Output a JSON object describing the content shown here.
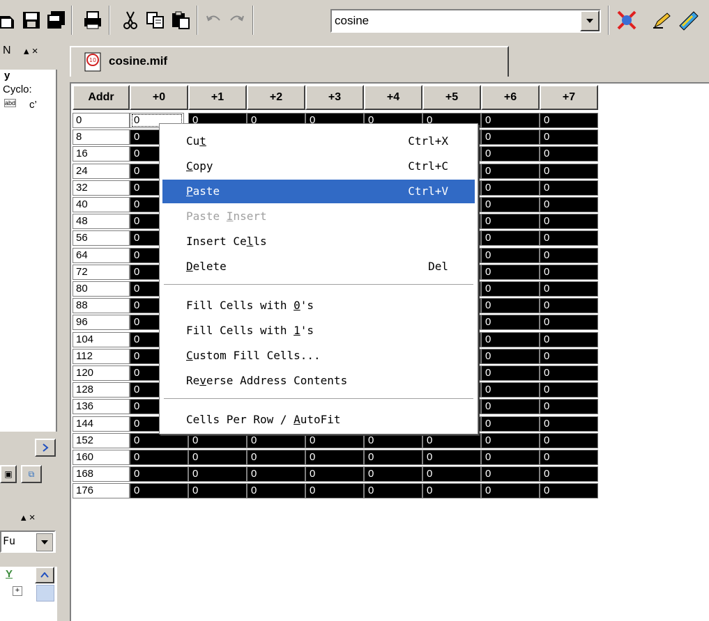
{
  "toolbar": {
    "combo_value": "cosine",
    "buttons": [
      "open-icon",
      "save-icon",
      "save-all-icon",
      "print-icon",
      "cut-icon",
      "copy-icon",
      "paste-icon",
      "undo-icon",
      "redo-icon"
    ],
    "right_icons": [
      "compile-icon",
      "pencil-icon",
      "programmer-icon"
    ]
  },
  "left_panel": {
    "title": "N",
    "header_small": "y",
    "item1": "Cyclo:",
    "item2_icon": "abd",
    "item2_text": "c’",
    "lower_dropdown": "Fu"
  },
  "tab": {
    "label": "cosine.mif"
  },
  "grid": {
    "addr_header": "Addr",
    "col_headers": [
      "+0",
      "+1",
      "+2",
      "+3",
      "+4",
      "+5",
      "+6",
      "+7"
    ],
    "addresses": [
      "0",
      "8",
      "16",
      "24",
      "32",
      "40",
      "48",
      "56",
      "64",
      "72",
      "80",
      "88",
      "96",
      "104",
      "112",
      "120",
      "128",
      "136",
      "144",
      "152",
      "160",
      "168",
      "176"
    ],
    "cell_value": "0"
  },
  "context_menu": {
    "items": [
      {
        "label": "Cut",
        "u": "t",
        "shortcut": "Ctrl+X"
      },
      {
        "label": "Copy",
        "u": "C",
        "shortcut": "Ctrl+C"
      },
      {
        "label": "Paste",
        "u": "P",
        "shortcut": "Ctrl+V"
      },
      {
        "label": "Paste Insert",
        "u": "I",
        "shortcut": ""
      },
      {
        "label": "Insert Cells",
        "u": "l",
        "shortcut": ""
      },
      {
        "label": "Delete",
        "u": "D",
        "shortcut": "Del"
      },
      {
        "label": "Fill Cells with 0's",
        "u": "0",
        "shortcut": ""
      },
      {
        "label": "Fill Cells with 1's",
        "u": "1",
        "shortcut": ""
      },
      {
        "label": "Custom Fill Cells...",
        "u": "C",
        "shortcut": ""
      },
      {
        "label": "Reverse Address Contents",
        "u": "v",
        "shortcut": ""
      },
      {
        "label": "Cells Per Row / AutoFit",
        "u": "A",
        "shortcut": ""
      }
    ]
  },
  "colors": {
    "highlight": "#316ac5",
    "cell_bg": "#000000",
    "chrome": "#d4d0c8"
  }
}
